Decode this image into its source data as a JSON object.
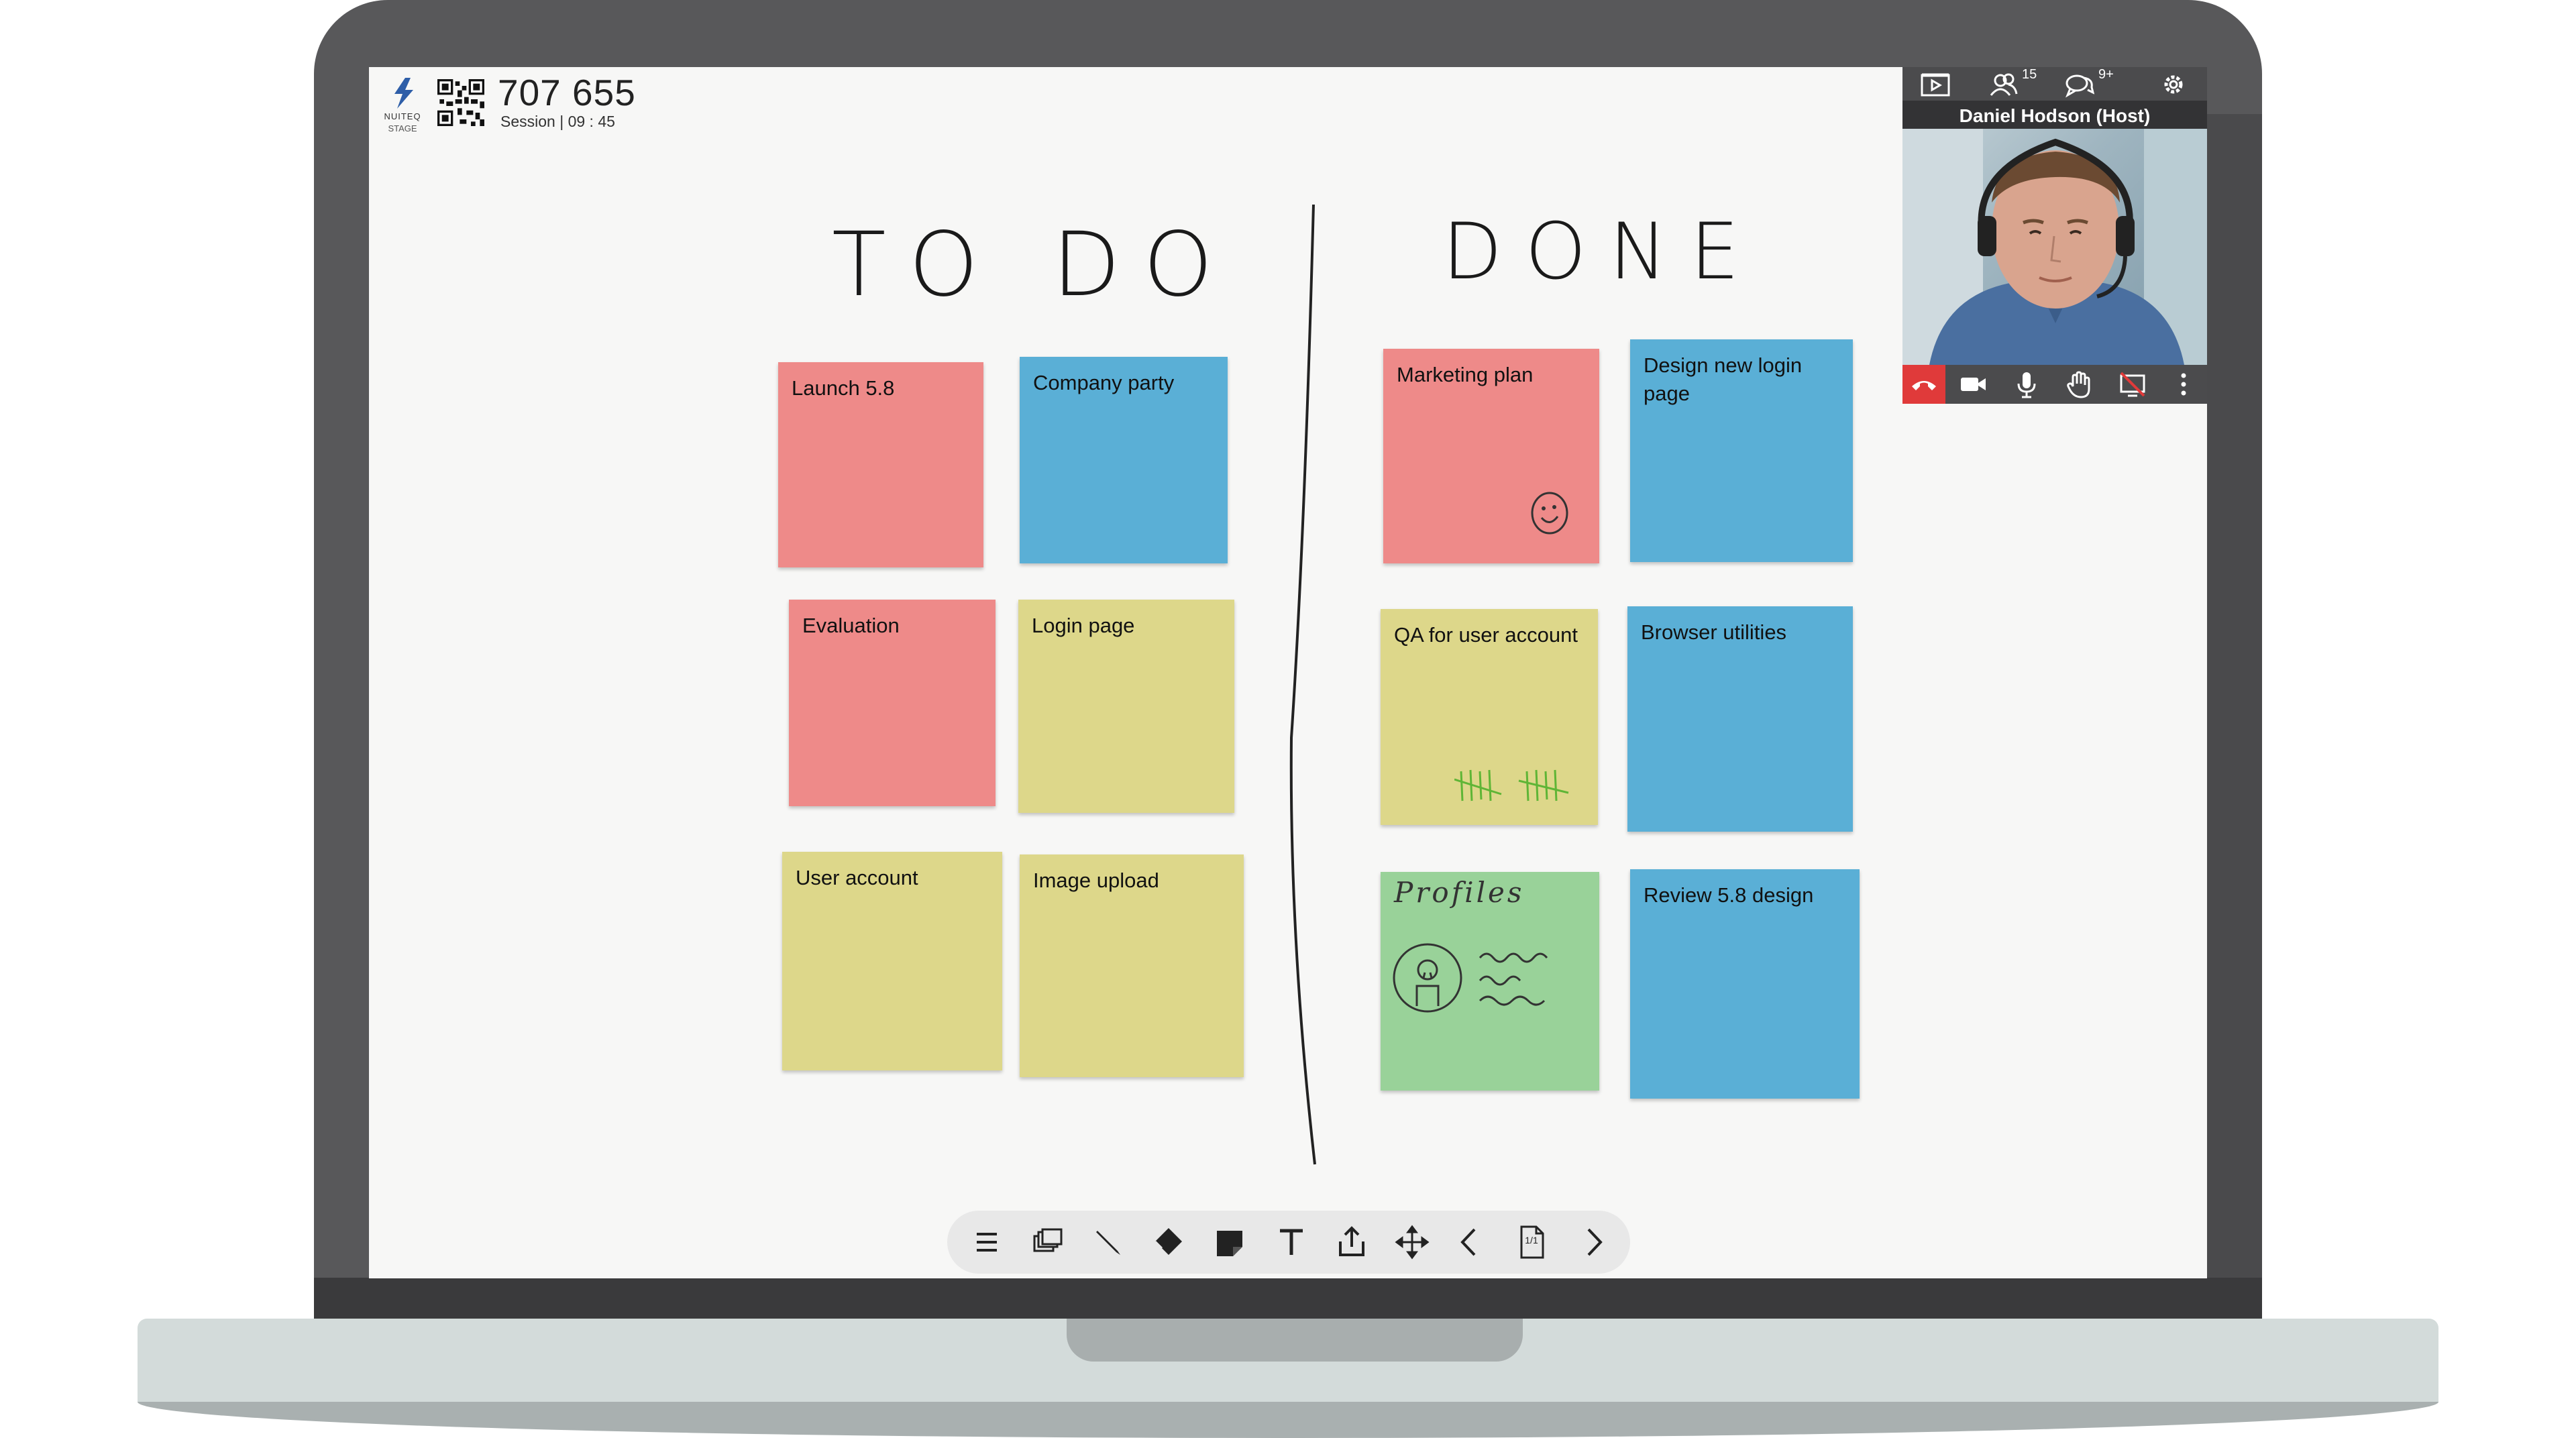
{
  "app": {
    "brand_line1": "NUITEQ",
    "brand_line2": "STAGE",
    "session_code": "707 655",
    "session_info": "Session | 09 : 45"
  },
  "board": {
    "todo_heading": "TO DO",
    "done_heading": "DONE",
    "todo_notes": [
      {
        "label": "Launch 5.8",
        "color": "#ee8a89"
      },
      {
        "label": "Company party",
        "color": "#5aafd6"
      },
      {
        "label": "Evaluation",
        "color": "#ee8a89"
      },
      {
        "label": "Login page",
        "color": "#ddd78a"
      },
      {
        "label": "User account",
        "color": "#ddd78a"
      },
      {
        "label": "Image upload",
        "color": "#ddd78a"
      }
    ],
    "done_notes": [
      {
        "label": "Marketing plan",
        "color": "#ee8a89"
      },
      {
        "label": "Design new login page",
        "color": "#5aafd6"
      },
      {
        "label": "QA for user account",
        "color": "#ddd78a"
      },
      {
        "label": "Browser utilities",
        "color": "#5aafd6"
      },
      {
        "label": "Profiles",
        "color": "#99d299"
      },
      {
        "label": "Review 5.8 design",
        "color": "#5aafd6"
      }
    ]
  },
  "video": {
    "participants_count": "15",
    "chat_count": "9+",
    "host_name": "Daniel Hodson (Host)"
  },
  "toolbar": {
    "items": [
      "menu-icon",
      "canvases-icon",
      "pen-icon",
      "eraser-icon",
      "sticky-note-icon",
      "text-icon",
      "share-icon",
      "move-icon",
      "previous-page-icon",
      "page-icon",
      "next-page-icon"
    ],
    "page_indicator": "1/1"
  }
}
